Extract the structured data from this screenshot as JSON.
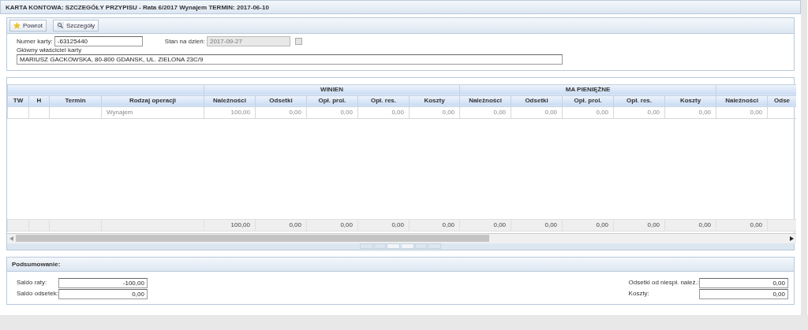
{
  "window": {
    "title": "KARTA KONTOWA: SZCZEGÓŁY PRZYPISU - Rata 6/2017 Wynajem TERMIN: 2017-06-10"
  },
  "toolbar": [
    {
      "label": "Powrot"
    },
    {
      "label": "Szczegóły"
    }
  ],
  "form": {
    "card_number_label": "Numer karty:",
    "card_number": "-63125440",
    "date_label": "Stan na dzień:",
    "date": "2017-09-27",
    "date_disabled": true,
    "owner_label": "Główny właściciel karty",
    "owner": "MARIUSZ GACKOWSKA, 80-800 GDANSK, UL. ZIELONA 23C/9"
  },
  "table": {
    "groups": [
      "WINIEN",
      "MA PIENIĘŻNE"
    ],
    "columns": [
      "TW",
      "H",
      "Termin",
      "Rodzaj operacji",
      "Należności",
      "Odsetki",
      "Opł. prol.",
      "Opł. res.",
      "Koszty",
      "Należności",
      "Odsetki",
      "Opł. prol.",
      "Opł. res.",
      "Koszty",
      "Należności",
      "Odse"
    ],
    "rows": [
      {
        "operation": "Wynajem",
        "values": [
          "100,00",
          "0,00",
          "0,00",
          "0,00",
          "0,00",
          "0,00",
          "0,00",
          "0,00",
          "0,00",
          "0,00",
          "0,00"
        ]
      }
    ],
    "totals": [
      "100,00",
      "0,00",
      "0,00",
      "0,00",
      "0,00",
      "0,00",
      "0,00",
      "0,00",
      "0,00",
      "0,00",
      "0,00"
    ]
  },
  "summary": {
    "title": "Podsumowanie:",
    "fields": [
      {
        "label": "Saldo raty:",
        "value": "-100,00"
      },
      {
        "label": "Odsetki od niespł. naleź.:",
        "value": "0,00"
      },
      {
        "label": "Saldo odsetek:",
        "value": "0,00"
      },
      {
        "label": "Koszty:",
        "value": "0,00"
      }
    ]
  }
}
